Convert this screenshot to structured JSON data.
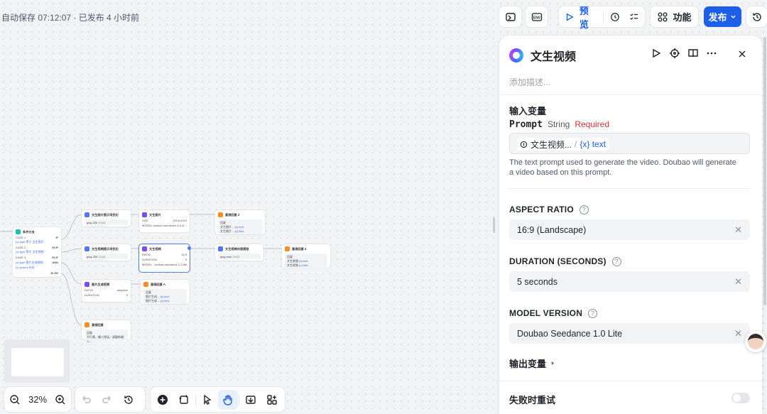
{
  "header": {
    "autosave": "自动保存 07:12:07 · 已发布 4 小时前",
    "preview_label": "预览",
    "features_label": "功能",
    "publish_label": "发布"
  },
  "panel": {
    "title": "文生视频",
    "description_placeholder": "添加描述...",
    "inputs_title": "输入变量",
    "prompt": {
      "name": "Prompt",
      "type": "String",
      "required": "Required",
      "chip_source": "文生视频...",
      "chip_sep": "/",
      "chip_var": "{x} text",
      "help": "The text prompt used to generate the video. Doubao will generate a video based on this prompt."
    },
    "aspect_ratio": {
      "label": "ASPECT RATIO",
      "value": "16:9 (Landscape)"
    },
    "duration": {
      "label": "DURATION (SECONDS)",
      "value": "5 seconds"
    },
    "model_version": {
      "label": "MODEL VERSION",
      "value": "Doubao Seedance 1.0 Lite"
    },
    "outputs_title": "输出变量",
    "retry_title": "失败时重试",
    "retry_enabled": false
  },
  "zoom": "32%",
  "nodes": {
    "branch": {
      "title": "条件分支",
      "rows": [
        [
          "CASE 1",
          "IF"
        ],
        [
          "{x} type 等于 文生图片",
          ""
        ],
        [
          "CASE 2",
          "ELIF"
        ],
        [
          "{x} type 等于 文生视频",
          ""
        ],
        [
          "CASE 3",
          "ELIF"
        ],
        [
          "{x} type 图片生成视频",
          "AND"
        ],
        [
          "{x} picture 存在",
          ""
        ],
        [
          "",
          "ELSE"
        ]
      ]
    },
    "t2i_prompt": {
      "title": "文生图片提示词优化",
      "model": "qwq-32b",
      "tag": "CHAT"
    },
    "t2i": {
      "title": "文生图片",
      "k1": "SIZE",
      "v1": "1024x1024",
      "k2": "MODEL",
      "v2": "doubao-seedream-3-0-t2..."
    },
    "reply2": {
      "title": "直接回复 2",
      "label": "回复",
      "l1": "文生图片...",
      "v1": "{x} text",
      "l2": "文生图片...",
      "v2": "{x} files"
    },
    "t2v_prompt": {
      "title": "文生视频提示词优化",
      "model": "qwq-32b",
      "tag": "CHAT"
    },
    "t2v": {
      "title": "文生视频",
      "k1": "RATIO",
      "v1": "16:9",
      "k2": "DURATION",
      "v2": "5",
      "k3": "MODEL",
      "v3": "doubao-seedance-1-0-lite"
    },
    "t2v_content": {
      "title": "文生视频内容提取",
      "model": "qwq-max",
      "tag": "CHAT"
    },
    "reply4": {
      "title": "直接回复 4",
      "label": "回复",
      "l1": "文生视频",
      "v1": "{x} text",
      "l2": "文生视频",
      "v2": "{x} files"
    },
    "i2v": {
      "title": "图片生成视频",
      "k1": "RATIO",
      "v1": "adaptive",
      "k2": "DURATION",
      "v2": "5"
    },
    "replyA": {
      "title": "直接回复 A",
      "label": "回复",
      "l1": "图片生成...",
      "v1": "{x} text",
      "l2": "图片生成...",
      "v2": "{x} files"
    },
    "replyE": {
      "title": "直接回复",
      "label": "回复",
      "text": "不行哦，输入错误，请重新输入..."
    }
  }
}
